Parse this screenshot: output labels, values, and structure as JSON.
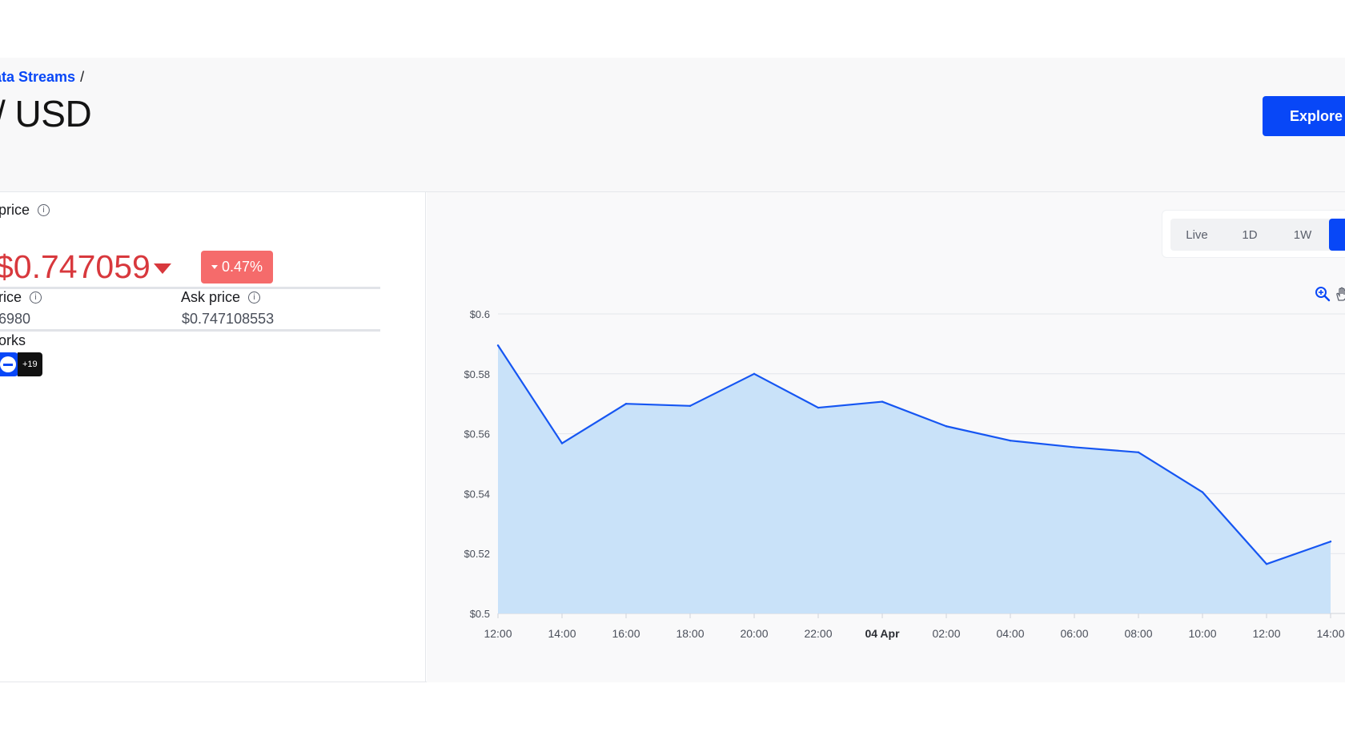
{
  "breadcrumb": {
    "link": "ata Streams",
    "separator": "/"
  },
  "page_title": "/ USD",
  "explore_button": "Explore",
  "price": {
    "label": "price",
    "value": "$0.747059",
    "change": "0.47%",
    "bid_label": "rice",
    "bid_value": "6980",
    "ask_label": "Ask price",
    "ask_value": "$0.747108553",
    "networks_label": "orks",
    "networks_more": "+19"
  },
  "range_tabs": [
    "Live",
    "1D",
    "1W"
  ],
  "colors": {
    "accent": "#0847f7",
    "negative": "#d8383d",
    "badge": "#f56b6b",
    "area_fill": "#c9e2f9",
    "line": "#1656f2"
  },
  "icons": {
    "info": "info-circle-icon",
    "zoom": "zoom-in-icon",
    "pan": "pan-hand-icon",
    "down": "caret-down-icon"
  },
  "chart_data": {
    "type": "area",
    "x": [
      "12:00",
      "14:00",
      "16:00",
      "18:00",
      "20:00",
      "22:00",
      "04 Apr",
      "02:00",
      "04:00",
      "06:00",
      "08:00",
      "10:00",
      "12:00",
      "14:00"
    ],
    "y": [
      0.5895,
      0.5568,
      0.57,
      0.5693,
      0.58,
      0.5687,
      0.5707,
      0.5625,
      0.5577,
      0.5555,
      0.5538,
      0.5405,
      0.5165,
      0.524
    ],
    "yticks": [
      "$0.5",
      "$0.52",
      "$0.54",
      "$0.56",
      "$0.58",
      "$0.6"
    ],
    "ylim": [
      0.5,
      0.6
    ],
    "bold_tick": "04 Apr",
    "grid": true
  }
}
